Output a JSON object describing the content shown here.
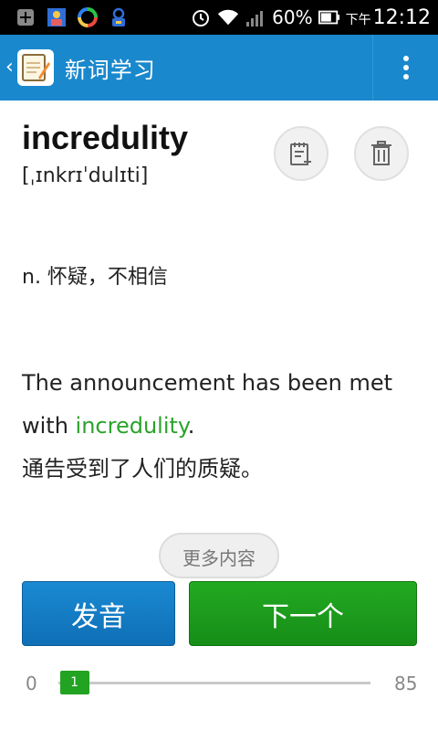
{
  "status_bar": {
    "battery_percent": "60%",
    "time_prefix": "下午",
    "time": "12:12",
    "icons": [
      "plus-box-icon",
      "contact-card-icon",
      "sync-icon",
      "lock-person-icon",
      "alarm-icon",
      "wifi-icon",
      "signal-icon",
      "battery-icon"
    ]
  },
  "app_bar": {
    "title": "新词学习",
    "logo": "word-notebook-icon",
    "menu_icon": "overflow-menu-icon"
  },
  "word": {
    "headword": "incredulity",
    "phonetic": "[ˌɪnkrɪˈdulɪti]",
    "definition": "n. 怀疑，不相信"
  },
  "example": {
    "before": "The announcement has been met with ",
    "highlight": "incredulity",
    "after": ".",
    "translation": "通告受到了人们的质疑。"
  },
  "actions": {
    "add_to_notebook_icon": "notebook-add-icon",
    "delete_icon": "trash-icon",
    "more_label": "更多内容",
    "speak_label": "发音",
    "next_label": "下一个"
  },
  "progress": {
    "min": "0",
    "max": "85",
    "current": "1",
    "current_value": 1,
    "max_value": 85,
    "accent": "#22a322"
  },
  "colors": {
    "app_bar": "#1a88cc",
    "speak_button": "#1a8ad2",
    "next_button": "#22aa22",
    "highlight": "#2aa32a"
  }
}
